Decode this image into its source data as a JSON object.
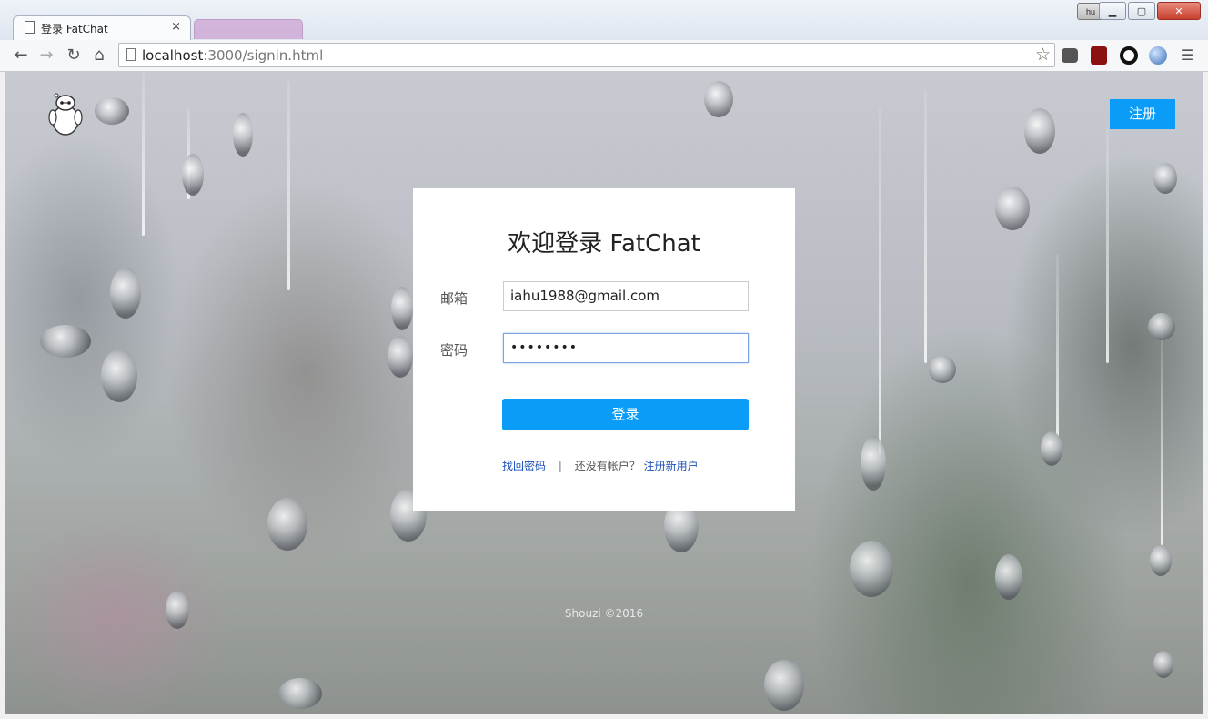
{
  "browser": {
    "tab_title": "登录 FatChat",
    "tab_close": "×",
    "profile_label": "hu",
    "url_host": "localhost",
    "url_rest": ":3000/signin.html",
    "window_buttons": {
      "minimize": "▁",
      "maximize": "▢",
      "close": "✕"
    }
  },
  "page": {
    "register_button": "注册",
    "heading": "欢迎登录 FatChat",
    "email_label": "邮箱",
    "email_value": "iahu1988@gmail.com",
    "password_label": "密码",
    "password_value": "••••••••",
    "login_button": "登录",
    "forgot_password": "找回密码",
    "separator": "|",
    "no_account": "还没有帐户？",
    "register_link": "注册新用户",
    "footer": "Shouzi ©2016"
  },
  "colors": {
    "accent": "#0a9cf7",
    "link": "#1a4fb8"
  }
}
